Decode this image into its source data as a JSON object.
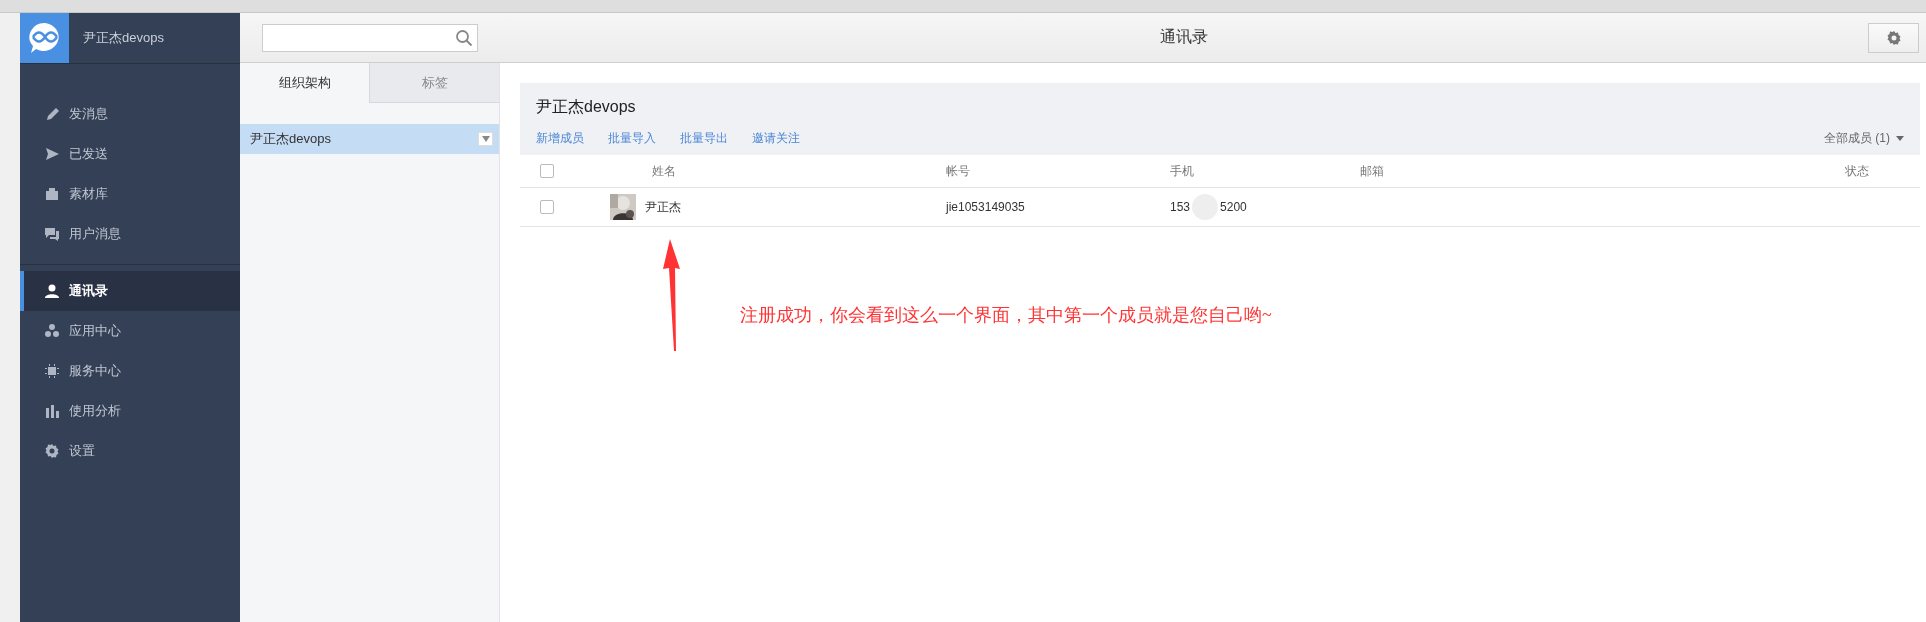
{
  "app": {
    "name": "尹正杰devops"
  },
  "sidebar": {
    "groups": [
      [
        {
          "label": "发消息",
          "selected": false
        },
        {
          "label": "已发送",
          "selected": false
        },
        {
          "label": "素材库",
          "selected": false
        },
        {
          "label": "用户消息",
          "selected": false
        }
      ],
      [
        {
          "label": "通讯录",
          "selected": true
        },
        {
          "label": "应用中心",
          "selected": false
        },
        {
          "label": "服务中心",
          "selected": false
        },
        {
          "label": "使用分析",
          "selected": false
        },
        {
          "label": "设置",
          "selected": false
        }
      ]
    ]
  },
  "page_title": "通讯录",
  "tree_panel": {
    "tabs": [
      {
        "label": "组织架构",
        "selected": true
      },
      {
        "label": "标签",
        "selected": false
      }
    ],
    "nodes": [
      {
        "label": "尹正杰devops",
        "selected": true
      }
    ]
  },
  "department": {
    "title": "尹正杰devops",
    "actions": [
      "新增成员",
      "批量导入",
      "批量导出",
      "邀请关注"
    ],
    "filter": "全部成员 (1)"
  },
  "table": {
    "columns": [
      "姓名",
      "帐号",
      "手机",
      "邮箱",
      "状态"
    ],
    "all_checked": false,
    "rows": [
      {
        "checked": false,
        "name": "尹正杰",
        "account": "jie1053149035",
        "phone_start": "153",
        "phone_end": "5200"
      }
    ]
  },
  "annotation": "注册成功，你会看到这么一个界面，其中第一个成员就是您自己哟~"
}
